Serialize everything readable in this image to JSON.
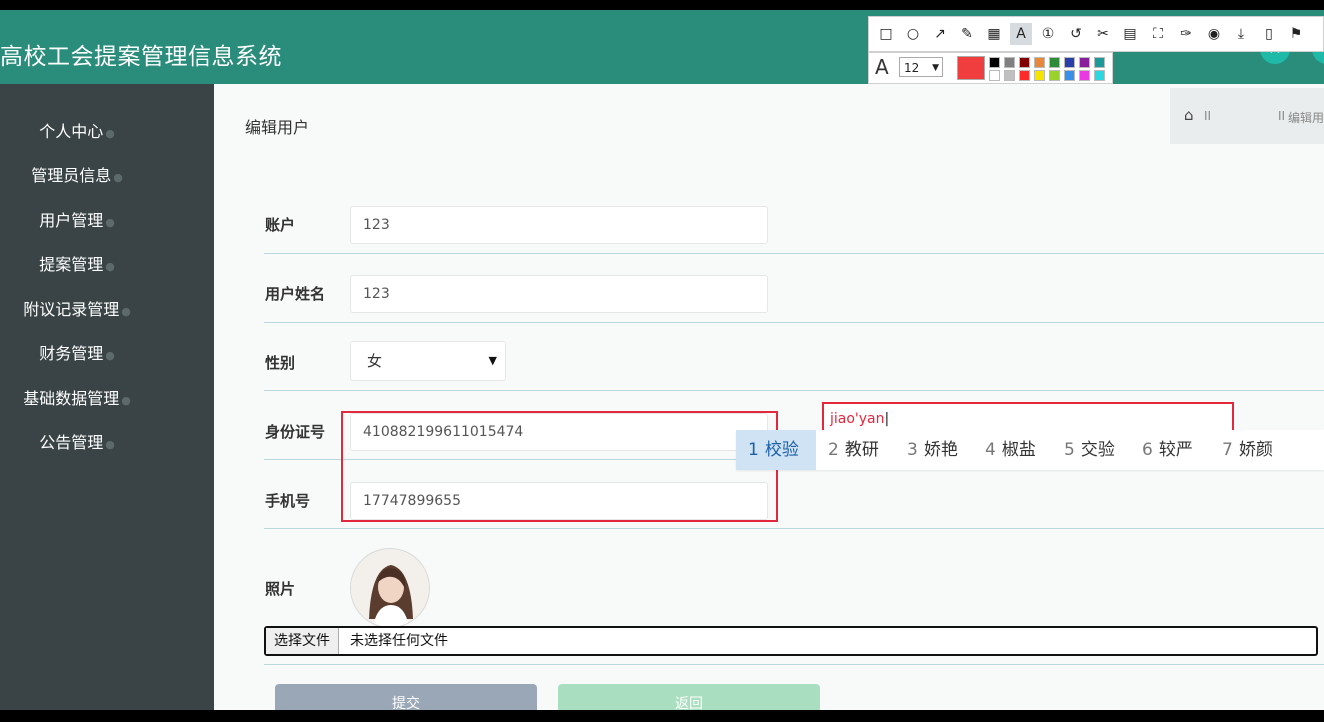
{
  "app": {
    "title": "高校工会提案管理信息系统"
  },
  "sidebar": {
    "items": [
      {
        "label": "个人中心"
      },
      {
        "label": "管理员信息"
      },
      {
        "label": "用户管理"
      },
      {
        "label": "提案管理"
      },
      {
        "label": "附议记录管理"
      },
      {
        "label": "财务管理"
      },
      {
        "label": "基础数据管理"
      },
      {
        "label": "公告管理"
      }
    ]
  },
  "breadcrumb": {
    "separator": "II",
    "current": "编辑用户"
  },
  "page": {
    "title": "编辑用户"
  },
  "form": {
    "account": {
      "label": "账户",
      "value": "123"
    },
    "name": {
      "label": "用户姓名",
      "value": "123"
    },
    "gender": {
      "label": "性别",
      "value": "女"
    },
    "id_card": {
      "label": "身份证号",
      "value": "410882199611015474"
    },
    "phone": {
      "label": "手机号",
      "value": "17747899655"
    },
    "photo": {
      "label": "照片",
      "file_button": "选择文件",
      "file_status": "未选择任何文件"
    }
  },
  "buttons": {
    "submit": "提交",
    "cancel": "返回"
  },
  "ime": {
    "composition": "jiao'yan",
    "candidates": [
      {
        "num": "1",
        "text": "校验"
      },
      {
        "num": "2",
        "text": "教研"
      },
      {
        "num": "3",
        "text": "娇艳"
      },
      {
        "num": "4",
        "text": "椒盐"
      },
      {
        "num": "5",
        "text": "交验"
      },
      {
        "num": "6",
        "text": "较严"
      },
      {
        "num": "7",
        "text": "娇颜"
      }
    ]
  },
  "annotation_toolbar": {
    "font_size": "12",
    "current_color": "#f03e3e",
    "tools": [
      "rectangle-icon",
      "ellipse-icon",
      "arrow-icon",
      "pen-icon",
      "mosaic-icon",
      "text-icon",
      "number-icon",
      "undo-icon",
      "pin-icon",
      "ocr-icon",
      "scroll-capture-icon",
      "pin-to-screen-icon",
      "record-icon",
      "save-icon",
      "copy-icon",
      "bookmark-icon"
    ],
    "palette": [
      "#000000",
      "#808080",
      "#800000",
      "#808000",
      "#008000",
      "#000080",
      "#800080",
      "#008080",
      "#ffffff",
      "#c0c0c0",
      "#ff0000",
      "#ffff00",
      "#00ff00",
      "#0000ff",
      "#ff00ff",
      "#00ffff"
    ]
  },
  "colors": {
    "header": "#2a8c7a",
    "sidebar": "#3a4446",
    "highlight": "#e3283d"
  }
}
